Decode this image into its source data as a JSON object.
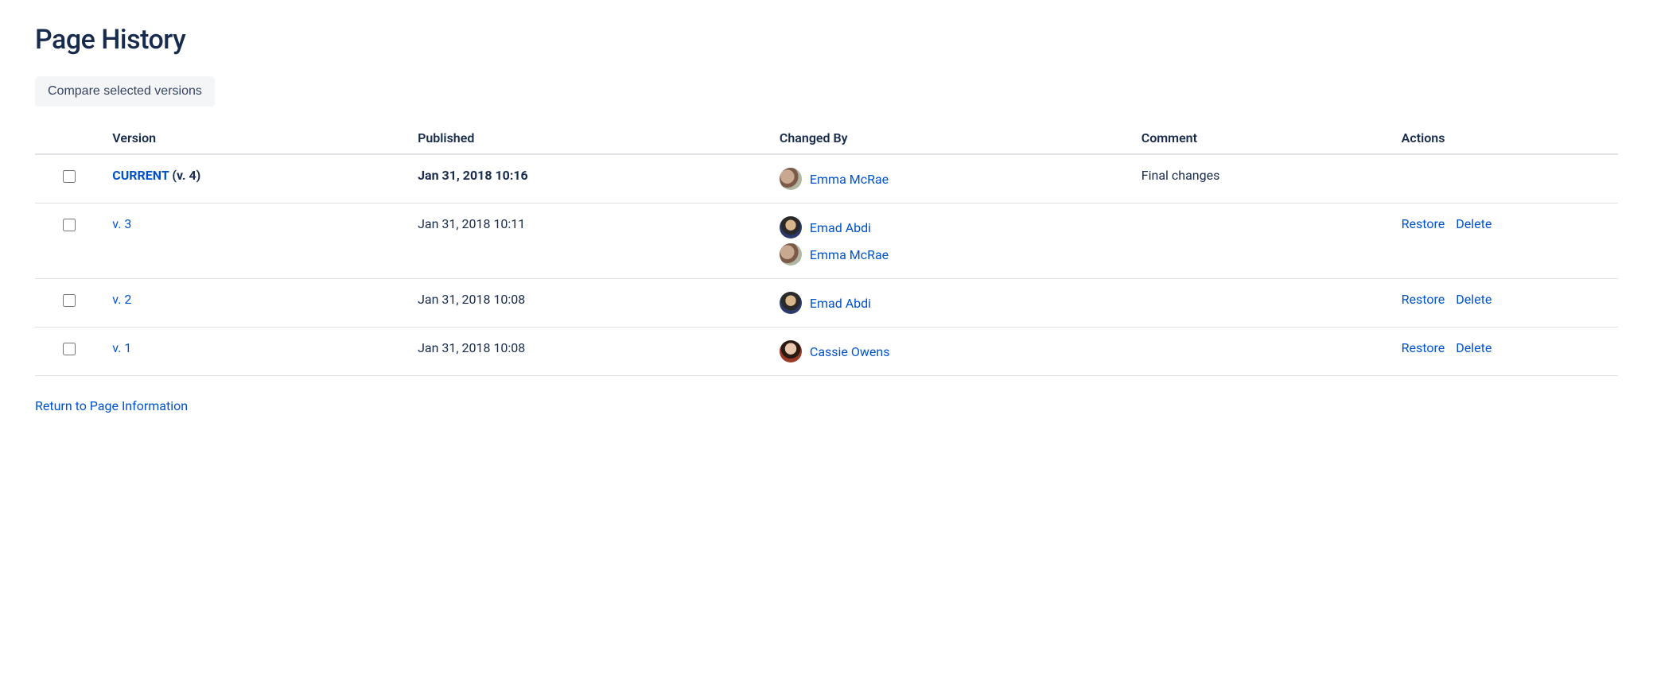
{
  "title": "Page History",
  "compare_label": "Compare selected versions",
  "columns": {
    "version": "Version",
    "published": "Published",
    "changed_by": "Changed By",
    "comment": "Comment",
    "actions": "Actions"
  },
  "rows": [
    {
      "is_current": true,
      "current_tag": "CURRENT",
      "version_text": "(v. 4)",
      "published": "Jan 31, 2018 10:16",
      "users": [
        {
          "name": "Emma McRae",
          "avatar_class": "av-emma"
        }
      ],
      "comment": "Final changes",
      "actions": []
    },
    {
      "is_current": false,
      "version_text": "v. 3",
      "published": "Jan 31, 2018 10:11",
      "users": [
        {
          "name": "Emad Abdi",
          "avatar_class": "av-emad"
        },
        {
          "name": "Emma McRae",
          "avatar_class": "av-emma"
        }
      ],
      "comment": "",
      "actions": [
        "Restore",
        "Delete"
      ]
    },
    {
      "is_current": false,
      "version_text": "v. 2",
      "published": "Jan 31, 2018 10:08",
      "users": [
        {
          "name": "Emad Abdi",
          "avatar_class": "av-emad"
        }
      ],
      "comment": "",
      "actions": [
        "Restore",
        "Delete"
      ]
    },
    {
      "is_current": false,
      "version_text": "v. 1",
      "published": "Jan 31, 2018 10:08",
      "users": [
        {
          "name": "Cassie Owens",
          "avatar_class": "av-cassie"
        }
      ],
      "comment": "",
      "actions": [
        "Restore",
        "Delete"
      ]
    }
  ],
  "return_label": "Return to Page Information"
}
